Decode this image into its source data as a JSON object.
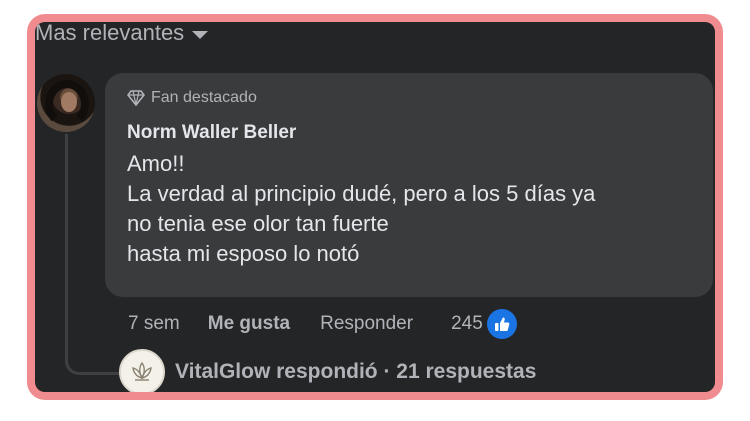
{
  "sort": {
    "label": "Mas relevantes"
  },
  "comment": {
    "badge": "Fan destacado",
    "author": "Norm Waller Beller",
    "lines": [
      "Amo!!",
      "La verdad al principio dudé, pero a los 5 días ya",
      "no tenia ese olor tan fuerte",
      "hasta mi esposo lo notó"
    ],
    "time": "7 sem",
    "like_label": "Me gusta",
    "reply_label": "Responder",
    "reaction_count": "245"
  },
  "replies": {
    "summary": "VitalGlow respondió · 21 respuestas"
  },
  "colors": {
    "frame": "#f08c8f",
    "background": "#242526",
    "bubble": "#3a3b3c",
    "like_blue": "#1b74e4"
  },
  "icons": [
    "caret-down-icon",
    "diamond-icon",
    "like-thumb-icon",
    "lotus-logo-icon"
  ]
}
